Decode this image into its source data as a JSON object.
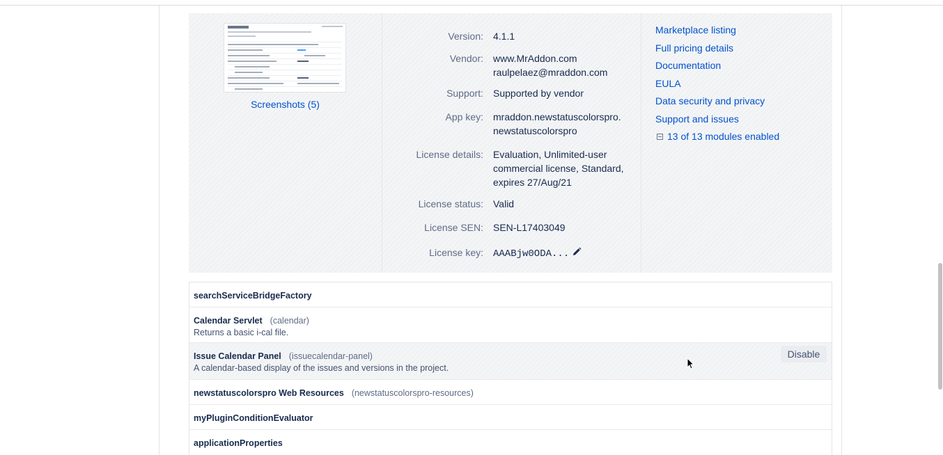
{
  "screenshots": {
    "link_label": "Screenshots (5)"
  },
  "details": [
    {
      "key": "Version:",
      "lines": [
        "4.1.1"
      ]
    },
    {
      "key": "Vendor:",
      "lines": [
        "www.MrAddon.com",
        "raulpelaez@mraddon.com"
      ]
    },
    {
      "key": "Support:",
      "lines": [
        "Supported by vendor"
      ]
    },
    {
      "key": "App key:",
      "lines": [
        "mraddon.newstatuscolorspro.",
        "newstatuscolorspro"
      ]
    },
    {
      "key": "License details:",
      "lines": [
        "Evaluation, Unlimited-user",
        "commercial license, Standard,",
        "expires 27/Aug/21"
      ]
    },
    {
      "key": "License status:",
      "lines": [
        "Valid"
      ]
    },
    {
      "key": "License SEN:",
      "lines": [
        "SEN-L17403049"
      ]
    },
    {
      "key": "License key:",
      "lines": [
        "AAABjw0ODA..."
      ]
    }
  ],
  "links": [
    "Marketplace listing",
    "Full pricing details",
    "Documentation",
    "EULA",
    "Data security and privacy",
    "Support and issues"
  ],
  "modules_toggle": {
    "label": "13 of 13 modules enabled",
    "icon": "collapse-minus-icon"
  },
  "modules": [
    {
      "name": "searchServiceBridgeFactory",
      "key": "",
      "description": ""
    },
    {
      "name": "Calendar Servlet",
      "key": "(calendar)",
      "description": "Returns a basic i-cal file."
    },
    {
      "name": "Issue Calendar Panel",
      "key": "(issuecalendar-panel)",
      "description": "A calendar-based display of the issues and versions in the project.",
      "hovered": true,
      "action": "Disable"
    },
    {
      "name": "newstatuscolorspro Web Resources",
      "key": "(newstatuscolorspro-resources)",
      "description": ""
    },
    {
      "name": "myPluginConditionEvaluator",
      "key": "",
      "description": ""
    },
    {
      "name": "applicationProperties",
      "key": "",
      "description": ""
    }
  ],
  "colors": {
    "link": "#0052cc",
    "panel_bg": "#f4f5f7",
    "label": "#5e6c84",
    "text": "#172b4d"
  },
  "icons": {
    "edit": "pencil-icon",
    "cursor": "mouse-pointer-icon"
  }
}
